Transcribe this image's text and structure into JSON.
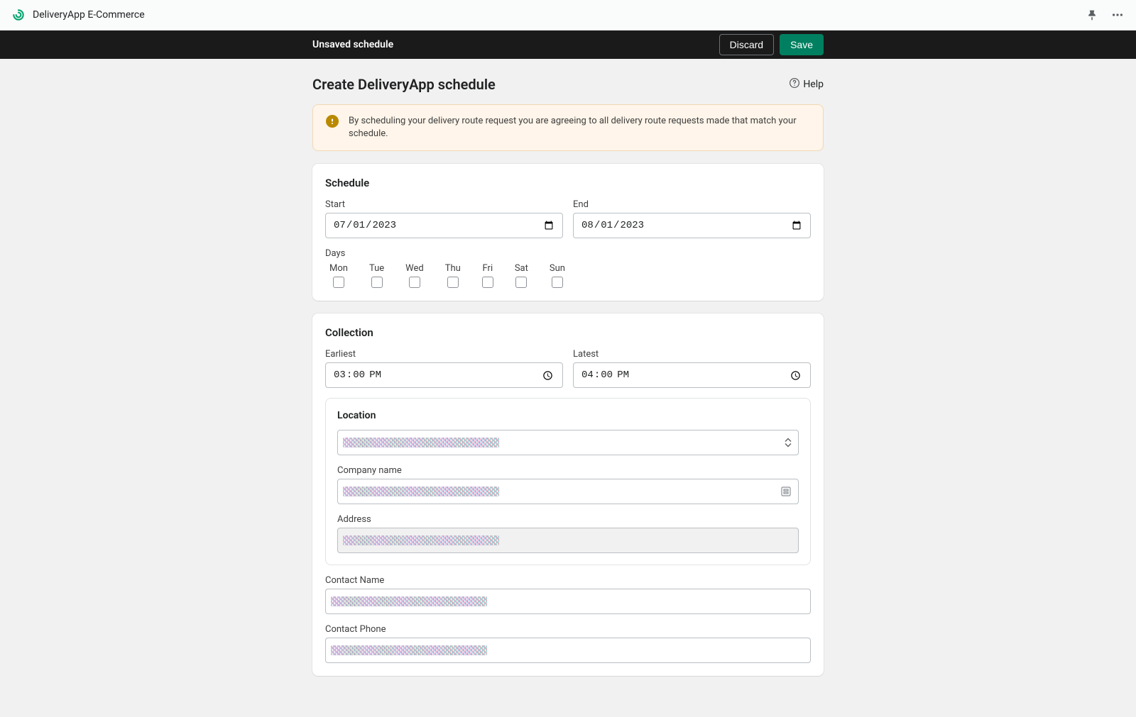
{
  "app": {
    "title": "DeliveryApp E-Commerce"
  },
  "save_bar": {
    "label": "Unsaved schedule",
    "discard": "Discard",
    "save": "Save"
  },
  "page": {
    "title": "Create DeliveryApp schedule",
    "help": "Help"
  },
  "banner": {
    "text": "By scheduling your delivery route request you are agreeing to all delivery route requests made that match your schedule."
  },
  "schedule": {
    "heading": "Schedule",
    "start_label": "Start",
    "start_value": "2023-07-01",
    "end_label": "End",
    "end_value": "2023-08-01",
    "days_label": "Days",
    "days": [
      "Mon",
      "Tue",
      "Wed",
      "Thu",
      "Fri",
      "Sat",
      "Sun"
    ]
  },
  "collection": {
    "heading": "Collection",
    "earliest_label": "Earliest",
    "earliest_value": "15:00",
    "latest_label": "Latest",
    "latest_value": "16:00",
    "location_heading": "Location",
    "company_label": "Company name",
    "address_label": "Address",
    "contact_name_label": "Contact Name",
    "contact_phone_label": "Contact Phone"
  },
  "icons": {
    "pin": "pin",
    "more": "more",
    "help": "help",
    "warning": "warning"
  }
}
